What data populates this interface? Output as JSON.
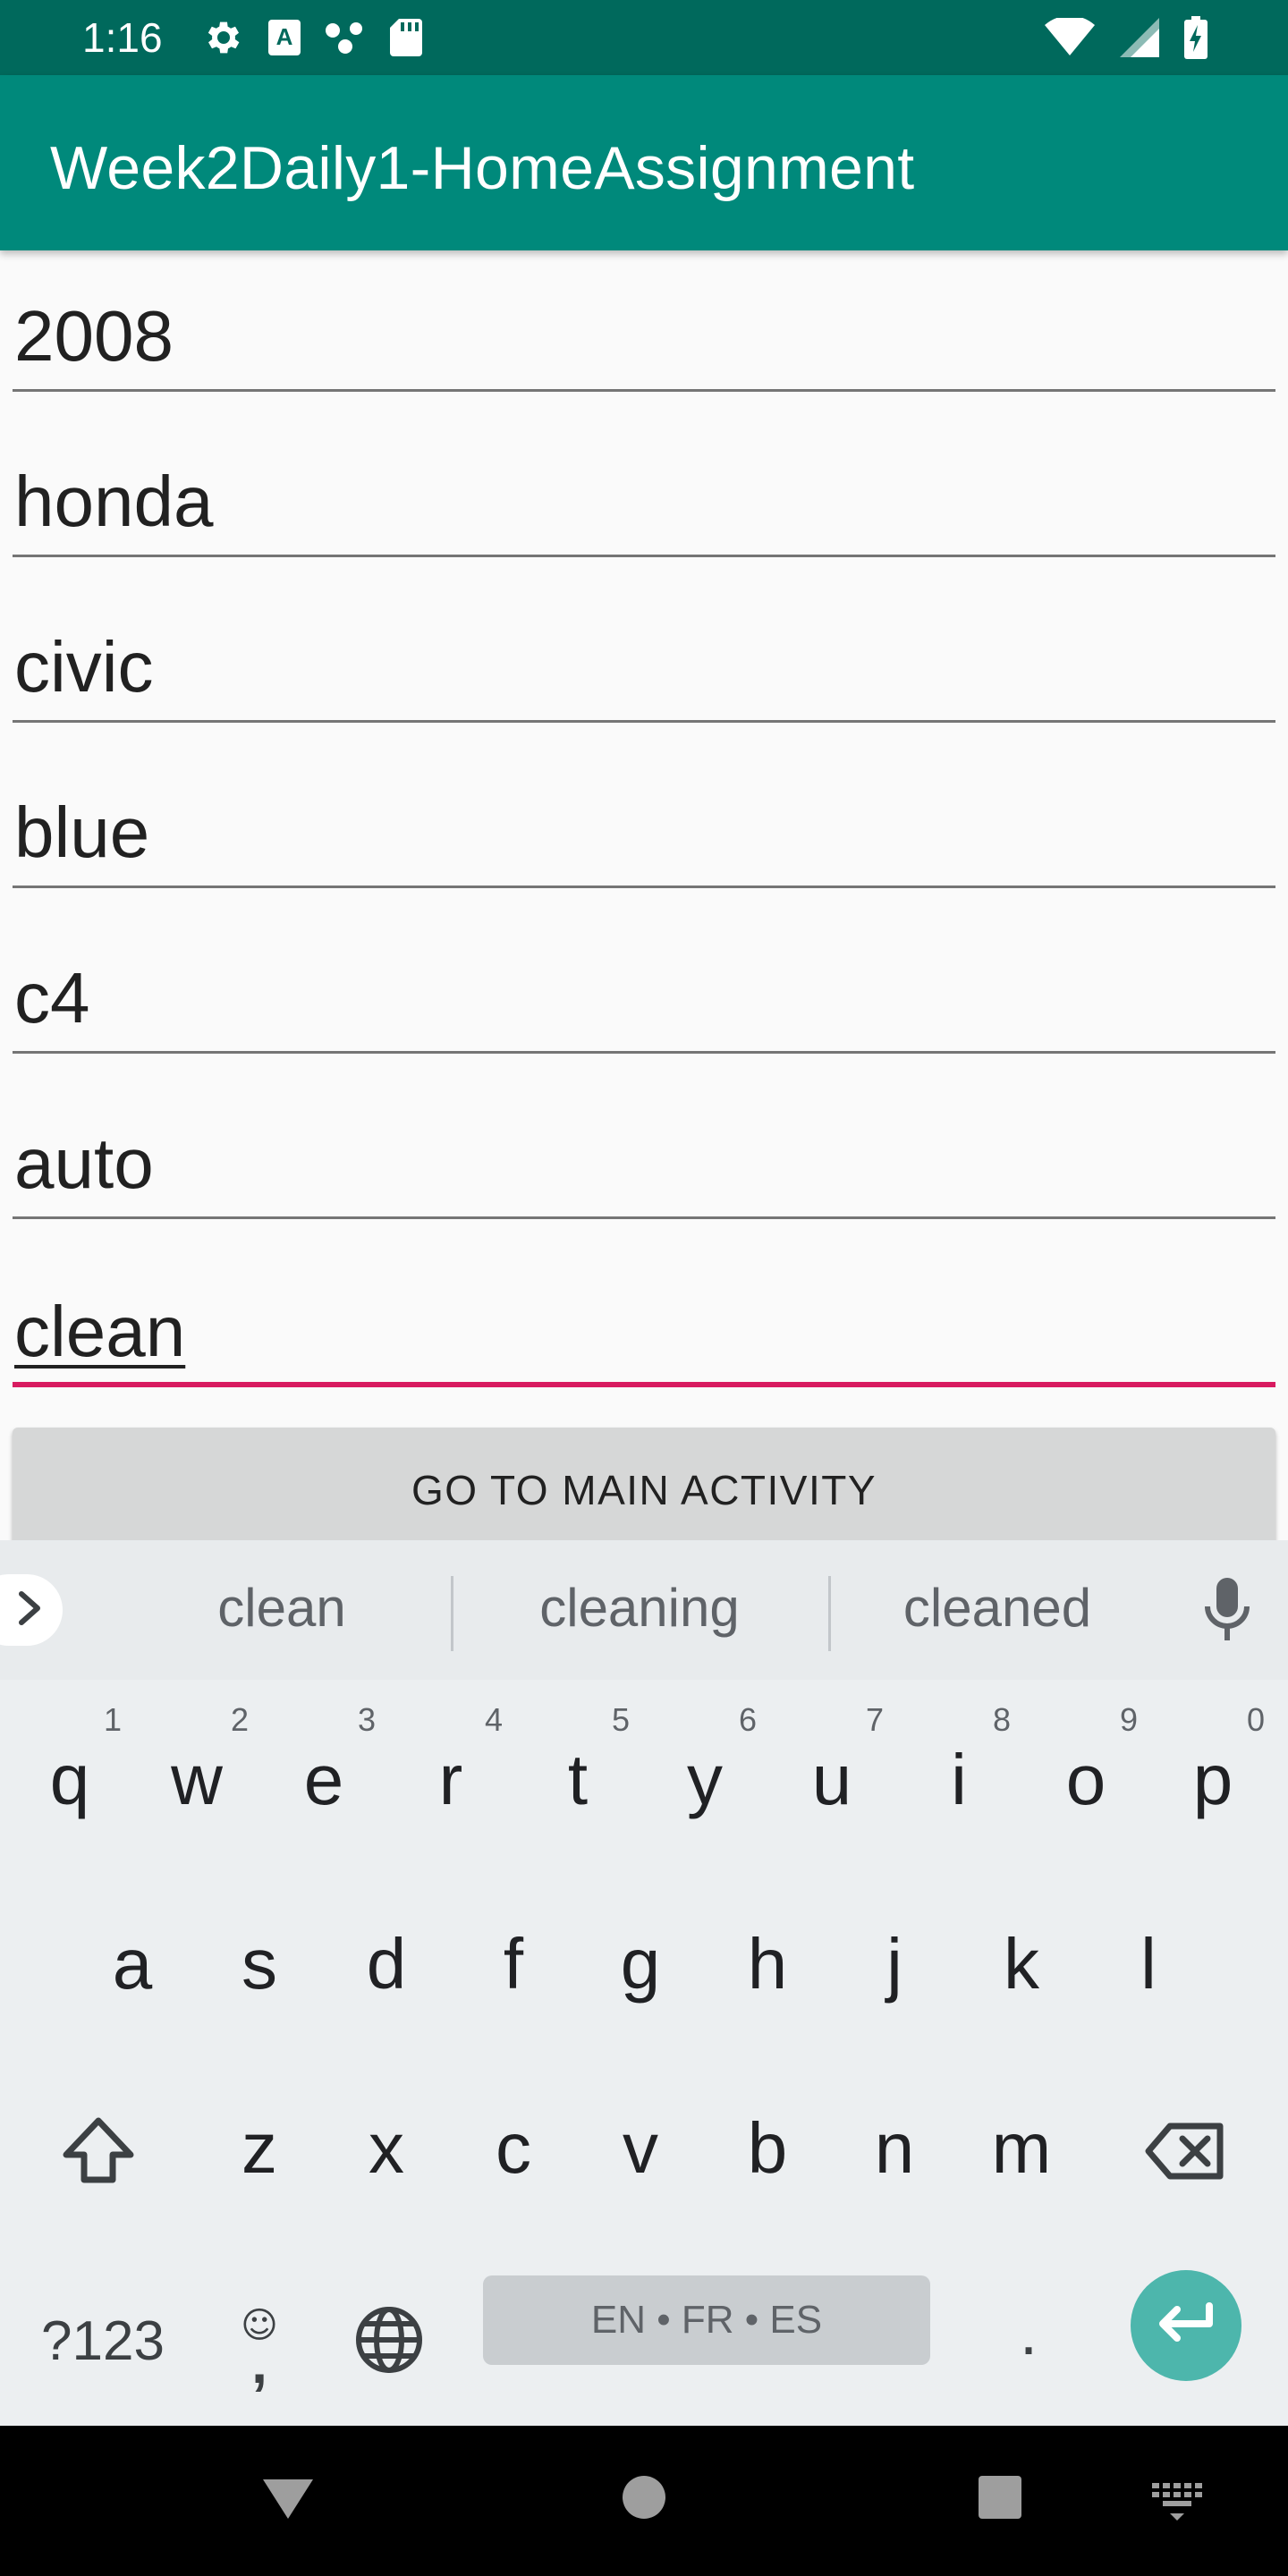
{
  "status_bar": {
    "time": "1:16",
    "left_icons": [
      "gear-icon",
      "keyboard-a-icon",
      "network-dots-icon",
      "sd-card-icon"
    ],
    "right_icons": [
      "wifi-icon",
      "cell-signal-icon",
      "battery-charging-icon"
    ]
  },
  "app_bar": {
    "title": "Week2Daily1-HomeAssignment",
    "color": "#00897b",
    "status_color": "#00695c"
  },
  "form": {
    "fields": [
      {
        "value": "2008"
      },
      {
        "value": "honda"
      },
      {
        "value": "civic"
      },
      {
        "value": "blue"
      },
      {
        "value": "c4"
      },
      {
        "value": "auto"
      },
      {
        "value": "clean",
        "focused": true
      }
    ],
    "accent_color": "#d81b60",
    "button_label": "GO TO MAIN ACTIVITY"
  },
  "keyboard": {
    "suggestions": [
      "clean",
      "cleaning",
      "cleaned"
    ],
    "row1": [
      {
        "char": "q",
        "hint": "1"
      },
      {
        "char": "w",
        "hint": "2"
      },
      {
        "char": "e",
        "hint": "3"
      },
      {
        "char": "r",
        "hint": "4"
      },
      {
        "char": "t",
        "hint": "5"
      },
      {
        "char": "y",
        "hint": "6"
      },
      {
        "char": "u",
        "hint": "7"
      },
      {
        "char": "i",
        "hint": "8"
      },
      {
        "char": "o",
        "hint": "9"
      },
      {
        "char": "p",
        "hint": "0"
      }
    ],
    "row2": [
      "a",
      "s",
      "d",
      "f",
      "g",
      "h",
      "j",
      "k",
      "l"
    ],
    "row3": [
      "z",
      "x",
      "c",
      "v",
      "b",
      "n",
      "m"
    ],
    "symbols_label": "?123",
    "emoji_glyph": "☺",
    "comma_label": ",",
    "space_label": "EN • FR • ES",
    "period_label": ".",
    "enter_color": "#4db6ac"
  },
  "nav_bar": {
    "buttons": [
      "back-icon",
      "home-icon",
      "recents-icon",
      "keyboard-switch-icon"
    ]
  }
}
